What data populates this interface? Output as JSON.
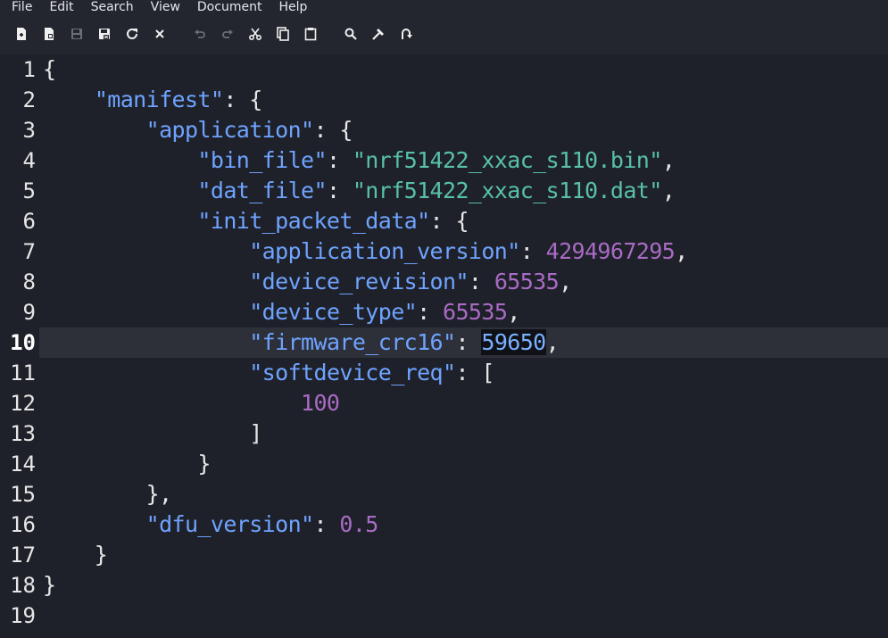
{
  "menu": [
    "File",
    "Edit",
    "Search",
    "View",
    "Document",
    "Help"
  ],
  "toolbar": {
    "buttons": [
      {
        "name": "new-document-icon",
        "label": "New"
      },
      {
        "name": "new-from-template-icon",
        "label": "New from template"
      },
      {
        "name": "save-icon",
        "label": "Save"
      },
      {
        "name": "save-all-icon",
        "label": "Save all"
      },
      {
        "name": "reload-icon",
        "label": "Reload"
      },
      {
        "name": "close-icon",
        "label": "Close"
      },
      {
        "name": "undo-icon",
        "label": "Undo"
      },
      {
        "name": "redo-icon",
        "label": "Redo"
      },
      {
        "name": "cut-icon",
        "label": "Cut"
      },
      {
        "name": "copy-icon",
        "label": "Copy"
      },
      {
        "name": "paste-icon",
        "label": "Paste"
      },
      {
        "name": "search-icon",
        "label": "Find"
      },
      {
        "name": "replace-icon",
        "label": "Replace"
      },
      {
        "name": "goto-icon",
        "label": "Go to"
      }
    ]
  },
  "editor": {
    "current_line": 10,
    "selected_text": "59650",
    "lines": [
      {
        "n": "1",
        "tokens": [
          [
            "p",
            "{"
          ]
        ]
      },
      {
        "n": "2",
        "tokens": [
          [
            "p",
            "    "
          ],
          [
            "k",
            "\"manifest\""
          ],
          [
            "p",
            ": {"
          ]
        ]
      },
      {
        "n": "3",
        "tokens": [
          [
            "p",
            "        "
          ],
          [
            "k",
            "\"application\""
          ],
          [
            "p",
            ": {"
          ]
        ]
      },
      {
        "n": "4",
        "tokens": [
          [
            "p",
            "            "
          ],
          [
            "k",
            "\"bin_file\""
          ],
          [
            "p",
            ": "
          ],
          [
            "s",
            "\"nrf51422_xxac_s110.bin\""
          ],
          [
            "p",
            ","
          ]
        ]
      },
      {
        "n": "5",
        "tokens": [
          [
            "p",
            "            "
          ],
          [
            "k",
            "\"dat_file\""
          ],
          [
            "p",
            ": "
          ],
          [
            "s",
            "\"nrf51422_xxac_s110.dat\""
          ],
          [
            "p",
            ","
          ]
        ]
      },
      {
        "n": "6",
        "tokens": [
          [
            "p",
            "            "
          ],
          [
            "k",
            "\"init_packet_data\""
          ],
          [
            "p",
            ": {"
          ]
        ]
      },
      {
        "n": "7",
        "tokens": [
          [
            "p",
            "                "
          ],
          [
            "k",
            "\"application_version\""
          ],
          [
            "p",
            ": "
          ],
          [
            "n",
            "4294967295"
          ],
          [
            "p",
            ","
          ]
        ]
      },
      {
        "n": "8",
        "tokens": [
          [
            "p",
            "                "
          ],
          [
            "k",
            "\"device_revision\""
          ],
          [
            "p",
            ": "
          ],
          [
            "n",
            "65535"
          ],
          [
            "p",
            ","
          ]
        ]
      },
      {
        "n": "9",
        "tokens": [
          [
            "p",
            "                "
          ],
          [
            "k",
            "\"device_type\""
          ],
          [
            "p",
            ": "
          ],
          [
            "n",
            "65535"
          ],
          [
            "p",
            ","
          ]
        ]
      },
      {
        "n": "10",
        "tokens": [
          [
            "p",
            "                "
          ],
          [
            "k",
            "\"firmware_crc16\""
          ],
          [
            "p",
            ": "
          ],
          [
            "sel",
            "59650"
          ],
          [
            "p",
            ","
          ]
        ]
      },
      {
        "n": "11",
        "tokens": [
          [
            "p",
            "                "
          ],
          [
            "k",
            "\"softdevice_req\""
          ],
          [
            "p",
            ": ["
          ]
        ]
      },
      {
        "n": "12",
        "tokens": [
          [
            "p",
            "                    "
          ],
          [
            "n",
            "100"
          ]
        ]
      },
      {
        "n": "13",
        "tokens": [
          [
            "p",
            "                ]"
          ]
        ]
      },
      {
        "n": "14",
        "tokens": [
          [
            "p",
            "            }"
          ]
        ]
      },
      {
        "n": "15",
        "tokens": [
          [
            "p",
            "        },"
          ]
        ]
      },
      {
        "n": "16",
        "tokens": [
          [
            "p",
            "        "
          ],
          [
            "k",
            "\"dfu_version\""
          ],
          [
            "p",
            ": "
          ],
          [
            "n",
            "0.5"
          ]
        ]
      },
      {
        "n": "17",
        "tokens": [
          [
            "p",
            "    }"
          ]
        ]
      },
      {
        "n": "18",
        "tokens": [
          [
            "p",
            "}"
          ]
        ]
      },
      {
        "n": "19",
        "tokens": []
      }
    ]
  }
}
